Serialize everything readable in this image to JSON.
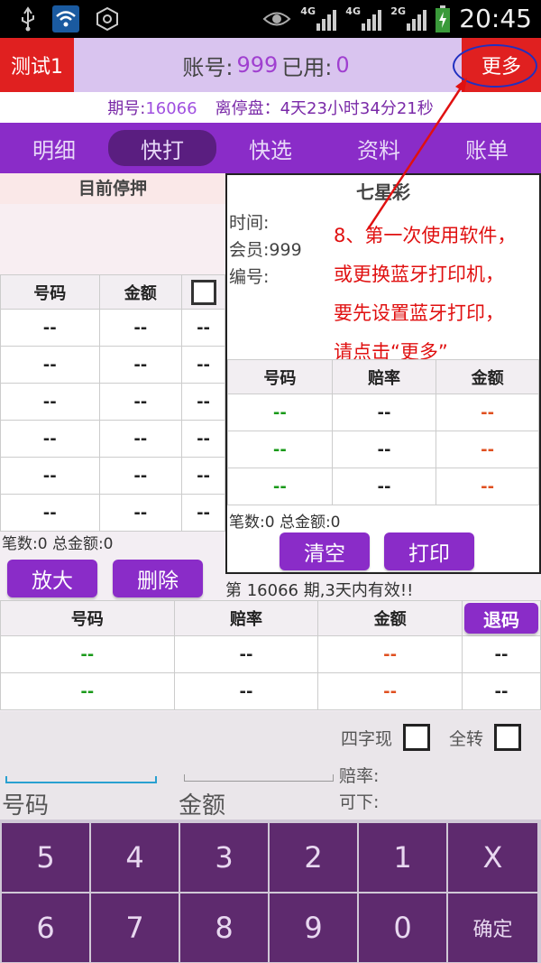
{
  "status_bar": {
    "time": "20:45",
    "signal_labels": [
      "4G",
      "4G",
      "2G"
    ],
    "left_icons": [
      "usb-icon",
      "wifi-icon",
      "settings-hex-icon"
    ],
    "right_icons": [
      "eye-icon",
      "signal-icon",
      "battery-icon"
    ]
  },
  "header": {
    "test_button": "测试1",
    "account_label": "账号:",
    "account_value": "999",
    "used_label": "已用:",
    "used_value": "0",
    "more_button": "更多"
  },
  "period": {
    "label": "期号:",
    "value": "16066",
    "stop_label": "离停盘：",
    "stop_value": "4天23小时34分21秒"
  },
  "tabs": [
    {
      "label": "明细",
      "active": false
    },
    {
      "label": "快打",
      "active": true
    },
    {
      "label": "快选",
      "active": false
    },
    {
      "label": "资料",
      "active": false
    },
    {
      "label": "账单",
      "active": false
    }
  ],
  "left_panel": {
    "title": "目前停押",
    "columns": [
      "号码",
      "金额"
    ],
    "rows": [
      [
        "--",
        "--",
        "--"
      ],
      [
        "--",
        "--",
        "--"
      ],
      [
        "--",
        "--",
        "--"
      ],
      [
        "--",
        "--",
        "--"
      ],
      [
        "--",
        "--",
        "--"
      ],
      [
        "--",
        "--",
        "--"
      ]
    ],
    "summary": "笔数:0  总金额:0",
    "enlarge_button": "放大",
    "delete_button": "删除"
  },
  "right_panel": {
    "title": "七星彩",
    "time_label": "时间:",
    "member_label": "会员:999",
    "code_label": "编号:",
    "annotation": [
      "8、第一次使用软件，",
      "或更换蓝牙打印机，",
      "要先设置蓝牙打印，",
      "请点击“更多”"
    ],
    "columns": [
      "号码",
      "赔率",
      "金额"
    ],
    "rows": [
      [
        "--",
        "--",
        "--"
      ],
      [
        "--",
        "--",
        "--"
      ],
      [
        "--",
        "--",
        "--"
      ]
    ],
    "summary": "笔数:0  总金额:0",
    "clear_button": "清空",
    "print_button": "打印"
  },
  "valid_text": "第 16066 期,3天内有效!!",
  "bottom_table": {
    "columns": [
      "号码",
      "赔率",
      "金额"
    ],
    "refund_button": "退码",
    "rows": [
      [
        "--",
        "--",
        "--",
        "--"
      ],
      [
        "--",
        "--",
        "--",
        "--"
      ]
    ]
  },
  "input_area": {
    "four_digit_label": "四字现",
    "full_turn_label": "全转",
    "number_label": "号码",
    "amount_label": "金额",
    "rate_label": "赔率:",
    "can_bet_label": "可下:"
  },
  "keypad": {
    "row1": [
      "5",
      "4",
      "3",
      "2",
      "1",
      "X"
    ],
    "row2": [
      "6",
      "7",
      "8",
      "9",
      "0",
      "确定"
    ]
  },
  "colors": {
    "purple": "#8a2cc8",
    "red": "#e02020",
    "key": "#5e2a6e",
    "annotation": "#e01010"
  }
}
